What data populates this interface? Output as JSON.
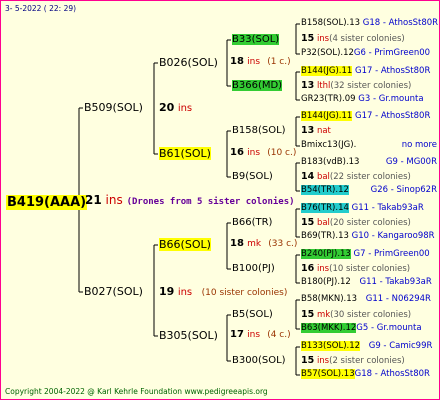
{
  "header": {
    "date": "3-  5-2022 ( 22:  29)"
  },
  "footer": {
    "copyright": "Copyright 2004-2022 @ Karl Kehrle Foundation    www.pedigreeapis.org"
  },
  "root": {
    "name": "B419(AAA)",
    "num": "21",
    "unit": "ins",
    "note": "(Drones from 5 sister colonies)"
  },
  "gen1": {
    "top": {
      "name": "B509(SOL)",
      "num": "20",
      "unit": "ins"
    },
    "bottom": {
      "name": "B027(SOL)",
      "num": "19",
      "unit": "ins",
      "note": "(10 sister colonies)"
    }
  },
  "gen2": {
    "a": {
      "name": "B026(SOL)",
      "num": "18",
      "unit": "ins",
      "note": "(1 c.)"
    },
    "b": {
      "name": "B61(SOL)",
      "num": "16",
      "unit": "ins",
      "note": "(10 c.)"
    },
    "c": {
      "name": "B66(SOL)",
      "num": "18",
      "unit": "mk",
      "note": "(33 c.)"
    },
    "d": {
      "name": "B305(SOL)",
      "num": "17",
      "unit": "ins",
      "note": "(4 c.)"
    }
  },
  "gen3": {
    "a": {
      "name": "B33(SOL)"
    },
    "b": {
      "name": "B366(MD)"
    },
    "c": {
      "name": "B158(SOL)"
    },
    "d": {
      "name": "B9(SOL)"
    },
    "e": {
      "name": "B66(TR)"
    },
    "f": {
      "name": "B100(PJ)"
    },
    "g": {
      "name": "B5(SOL)"
    },
    "h": {
      "name": "B300(SOL)"
    }
  },
  "gen4": {
    "r01": {
      "name": "B158(SOL).13",
      "extra": "G18 - AthosSt80R"
    },
    "r02": {
      "num": "15",
      "unit": "ins",
      "note": "(4 sister colonies)"
    },
    "r03": {
      "name": "P32(SOL).12",
      "extra": "G6 - PrimGreen00"
    },
    "r04": {
      "name": "B144(JG).11",
      "extra": "G17 - AthosSt80R"
    },
    "r05": {
      "num": "13",
      "unit": "lthl",
      "note": "(32 sister colonies)"
    },
    "r06": {
      "name": "GR23(TR).09",
      "extra": "G3 - Gr.mounta"
    },
    "r07": {
      "name": "B144(JG).11",
      "extra": "G17 - AthosSt80R"
    },
    "r08": {
      "num": "13",
      "unit": "nat"
    },
    "r09": {
      "name": "Bmixc13(JG).",
      "extra": "no more"
    },
    "r10": {
      "name": "B183(vdB).13",
      "extra": "G9 - MG00R"
    },
    "r11": {
      "num": "14",
      "unit": "bal",
      "note": "(22 sister colonies)"
    },
    "r12": {
      "name": "B54(TR).12",
      "extra": "G26 - Sinop62R"
    },
    "r13": {
      "name": "B76(TR).14",
      "extra": "G11 - Takab93aR"
    },
    "r14": {
      "num": "15",
      "unit": "bal",
      "note": "(20 sister colonies)"
    },
    "r15": {
      "name": "B69(TR).13",
      "extra": "G10 - Kangaroo98R"
    },
    "r16": {
      "name": "B240(PJ).13",
      "extra": "G7 - PrimGreen00"
    },
    "r17": {
      "num": "16",
      "unit": "ins",
      "note": "(10 sister colonies)"
    },
    "r18": {
      "name": "B180(PJ).12",
      "extra": "G11 - Takab93aR"
    },
    "r19": {
      "name": "B58(MKN).13",
      "extra": "G11 - N06294R"
    },
    "r20": {
      "num": "15",
      "unit": "mk",
      "note": "(30 sister colonies)"
    },
    "r21": {
      "name": "B63(MKK).12",
      "extra": "G5 - Gr.mounta"
    },
    "r22": {
      "name": "B133(SOL).12",
      "extra": "G9 - Camic99R"
    },
    "r23": {
      "num": "15",
      "unit": "ins",
      "note": "(2 sister colonies)"
    },
    "r24": {
      "name": "B57(SOL).13",
      "extra": "G18 - AthosSt80R"
    }
  }
}
